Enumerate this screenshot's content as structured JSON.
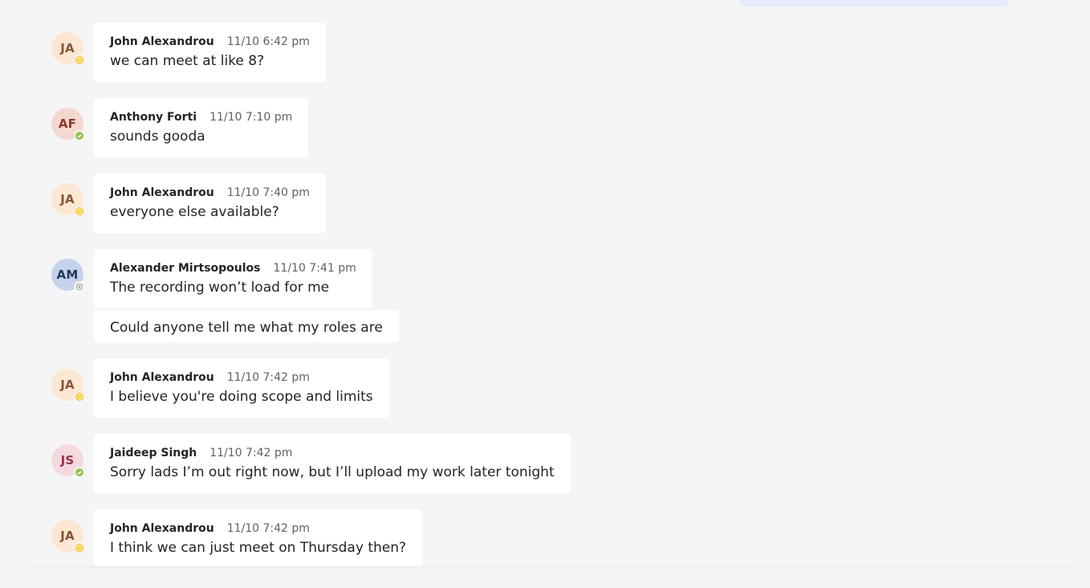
{
  "colors": {
    "page_background": "#f5f5f5",
    "message_bubble": "#ffffff",
    "own_message_bubble": "#e8ebfa",
    "presence_away": "#fdb913",
    "presence_available": "#92c353",
    "timestamp_text": "#616161"
  },
  "messages": [
    {
      "initials": "JA",
      "author": "John Alexandrou",
      "timestamp": "11/10 6:42 pm",
      "presence": "away-clock-icon",
      "text": "we can meet at like 8?"
    },
    {
      "initials": "AF",
      "author": "Anthony Forti",
      "timestamp": "11/10 7:10 pm",
      "presence": "available-check-icon",
      "text": "sounds gooda"
    },
    {
      "initials": "JA",
      "author": "John Alexandrou",
      "timestamp": "11/10 7:40 pm",
      "presence": "away-clock-icon",
      "text": "everyone else available?"
    },
    {
      "initials": "AM",
      "author": "Alexander Mirtsopoulos",
      "timestamp": "11/10 7:41 pm",
      "presence": "offline-x-icon",
      "text": "The recording won’t load for me",
      "continuation": "Could anyone tell me what my roles are"
    },
    {
      "initials": "JA",
      "author": "John Alexandrou",
      "timestamp": "11/10 7:42 pm",
      "presence": "away-clock-icon",
      "text": "I believe you're doing scope and limits"
    },
    {
      "initials": "JS",
      "author": "Jaideep Singh",
      "timestamp": "11/10 7:42 pm",
      "presence": "available-check-icon",
      "text": "Sorry lads I’m out right now, but I’ll upload my work later tonight"
    },
    {
      "initials": "JA",
      "author": "John Alexandrou",
      "timestamp": "11/10 7:42 pm",
      "presence": "away-clock-icon",
      "text": "I think we can just meet on Thursday then?"
    }
  ]
}
